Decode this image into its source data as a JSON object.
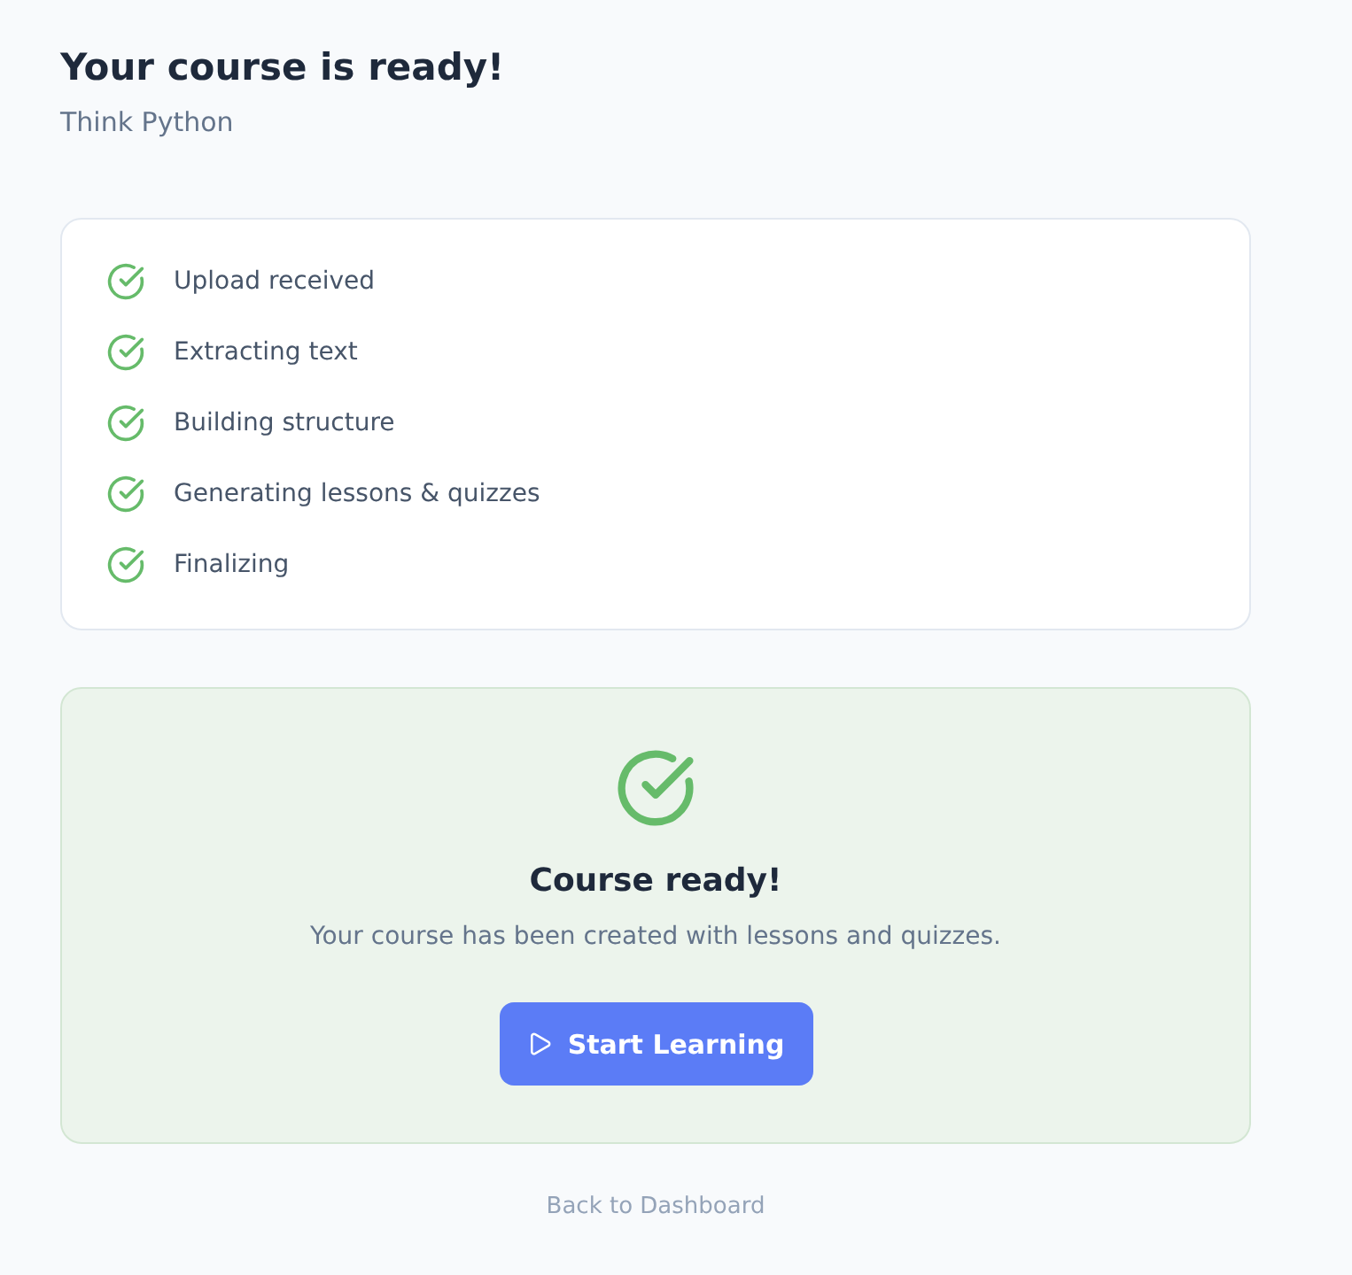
{
  "header": {
    "title": "Your course is ready!",
    "subtitle": "Think Python"
  },
  "steps": [
    {
      "label": "Upload received",
      "done": true
    },
    {
      "label": "Extracting text",
      "done": true
    },
    {
      "label": "Building structure",
      "done": true
    },
    {
      "label": "Generating lessons & quizzes",
      "done": true
    },
    {
      "label": "Finalizing",
      "done": true
    }
  ],
  "result": {
    "title": "Course ready!",
    "message": "Your course has been created with lessons and quizzes.",
    "button": {
      "label": "Start Learning"
    }
  },
  "footer": {
    "link": "Back to Dashboard"
  }
}
